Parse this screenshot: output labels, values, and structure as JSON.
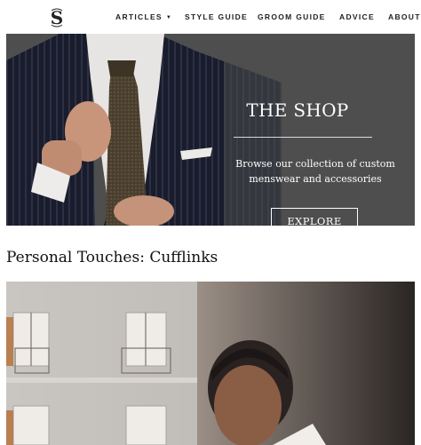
{
  "header": {
    "logo_icon": "monogram-logo-icon",
    "nav": [
      {
        "label": "ARTICLES",
        "has_dropdown": true
      },
      {
        "label": "STYLE GUIDE"
      },
      {
        "label": "GROOM GUIDE"
      },
      {
        "label": "ADVICE"
      },
      {
        "label": "ABOUT"
      }
    ]
  },
  "hero": {
    "title": "THE SHOP",
    "description": "Browse our collection of custom menswear and accessories",
    "button_label": "EXPLORE"
  },
  "section": {
    "title": "Personal Touches: Cufflinks"
  },
  "colors": {
    "text": "#222222",
    "hero_bg": "#4f4e4f",
    "white": "#ffffff"
  }
}
